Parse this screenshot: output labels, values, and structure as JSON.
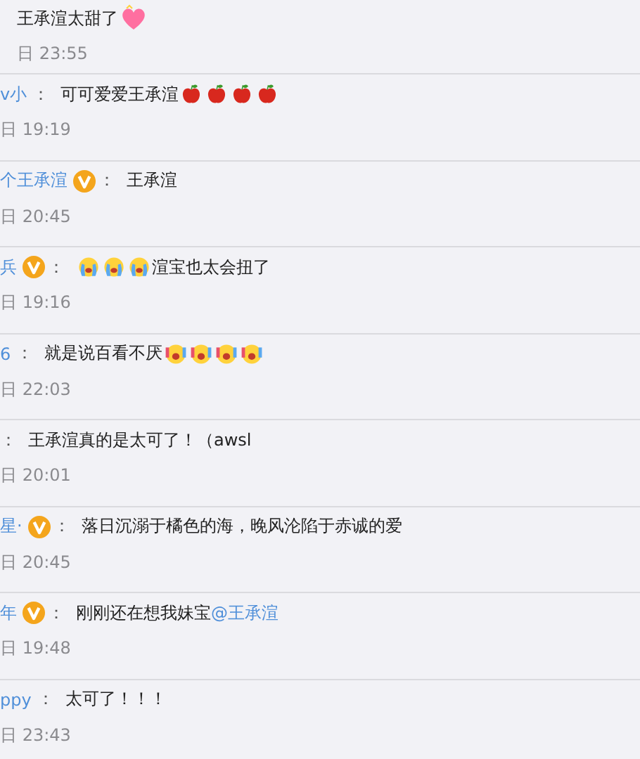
{
  "comments": [
    {
      "verified": false,
      "text": "王承渲太甜了",
      "emoji": [
        {
          "kind": "heart"
        }
      ],
      "time": "日 23:55"
    },
    {
      "name": "v小",
      "verified": false,
      "text": "可可爱爱王承渲",
      "emoji": [
        {
          "kind": "apple"
        },
        {
          "kind": "apple"
        },
        {
          "kind": "apple"
        },
        {
          "kind": "apple"
        }
      ],
      "time": "日 19:19"
    },
    {
      "name": "个王承渲",
      "verified": true,
      "text": "王承渲",
      "time": "日 20:45"
    },
    {
      "name": "兵",
      "verified": true,
      "emoji_before": [
        {
          "kind": "crying"
        },
        {
          "kind": "crying"
        },
        {
          "kind": "crying"
        }
      ],
      "text": "渲宝也太会扭了",
      "time": "日 19:16"
    },
    {
      "name": "6",
      "verified": false,
      "text": "就是说百看不厌",
      "emoji": [
        {
          "kind": "shouting"
        },
        {
          "kind": "shouting"
        },
        {
          "kind": "shouting"
        },
        {
          "kind": "shouting"
        }
      ],
      "time": "日 22:03"
    },
    {
      "verified": false,
      "text": "王承渲真的是太可了！（awsl",
      "time": "日 20:01"
    },
    {
      "name": "星·",
      "verified": true,
      "text": "落日沉溺于橘色的海，晚风沦陷于赤诚的爱",
      "time": "日 20:45"
    },
    {
      "name": "年",
      "verified": true,
      "text": "刚刚还在想我妹宝",
      "mention": "@王承渲",
      "time": "日 19:48"
    },
    {
      "name": "ppy",
      "verified": false,
      "text": "太可了！！！",
      "time": "日 23:43"
    }
  ],
  "colon": "："
}
